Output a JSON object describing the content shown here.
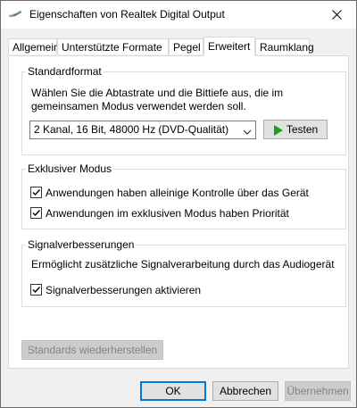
{
  "window": {
    "title": "Eigenschaften von Realtek Digital Output"
  },
  "tabs": [
    {
      "label": "Allgemein",
      "active": false
    },
    {
      "label": "Unterstützte Formate",
      "active": false
    },
    {
      "label": "Pegel",
      "active": false
    },
    {
      "label": "Erweitert",
      "active": true
    },
    {
      "label": "Raumklang",
      "active": false
    }
  ],
  "standardformat": {
    "heading": "Standardformat",
    "description_line1": "Wählen Sie die Abtastrate und die Bittiefe aus, die im",
    "description_line2": "gemeinsamen Modus verwendet werden soll.",
    "selected_format": "2 Kanal, 16 Bit, 48000 Hz (DVD-Qualität)",
    "test_button": "Testen"
  },
  "exclusive": {
    "heading": "Exklusiver Modus",
    "option1": {
      "label": "Anwendungen haben alleinige Kontrolle über das Gerät",
      "checked": true
    },
    "option2": {
      "label": "Anwendungen im exklusiven Modus haben Priorität",
      "checked": true
    }
  },
  "enhancements": {
    "heading": "Signalverbesserungen",
    "description": "Ermöglicht zusätzliche Signalverarbeitung durch das Audiogerät",
    "option": {
      "label": "Signalverbesserungen aktivieren",
      "checked": true
    }
  },
  "restore_defaults_button": "Standards wiederherstellen",
  "footer": {
    "ok": "OK",
    "cancel": "Abbrechen",
    "apply": "Übernehmen"
  },
  "colors": {
    "accent": "#0078d7",
    "play_green": "#1e9e1e"
  }
}
